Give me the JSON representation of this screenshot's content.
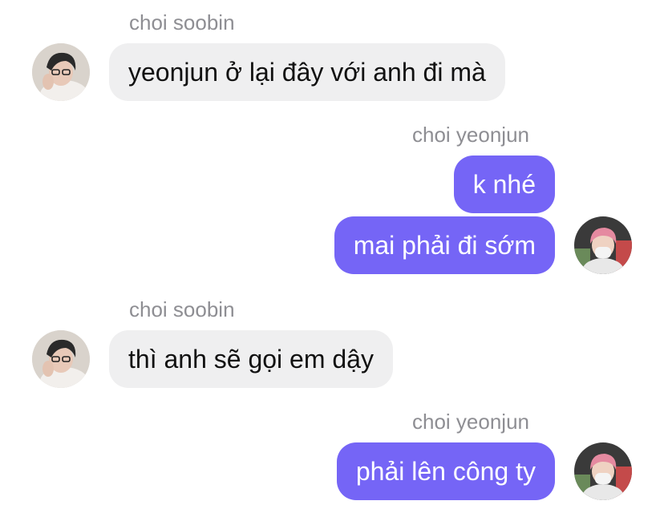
{
  "colors": {
    "outgoing_bubble": "#7565f6",
    "incoming_bubble": "#efeff0",
    "sender_name": "#8e8e93"
  },
  "messages": [
    {
      "sender": "choi soobin",
      "text": "yeonjun ở lại đây với anh đi mà",
      "direction": "incoming"
    },
    {
      "sender": "choi yeonjun",
      "text": "k nhé",
      "direction": "outgoing"
    },
    {
      "sender": "",
      "text": "mai phải đi sớm",
      "direction": "outgoing"
    },
    {
      "sender": "choi soobin",
      "text": "thì anh sẽ gọi em dậy",
      "direction": "incoming"
    },
    {
      "sender": "choi yeonjun",
      "text": "phải lên công ty",
      "direction": "outgoing"
    }
  ],
  "avatars": {
    "soobin": "avatar-soobin-photo",
    "yeonjun": "avatar-yeonjun-photo"
  }
}
